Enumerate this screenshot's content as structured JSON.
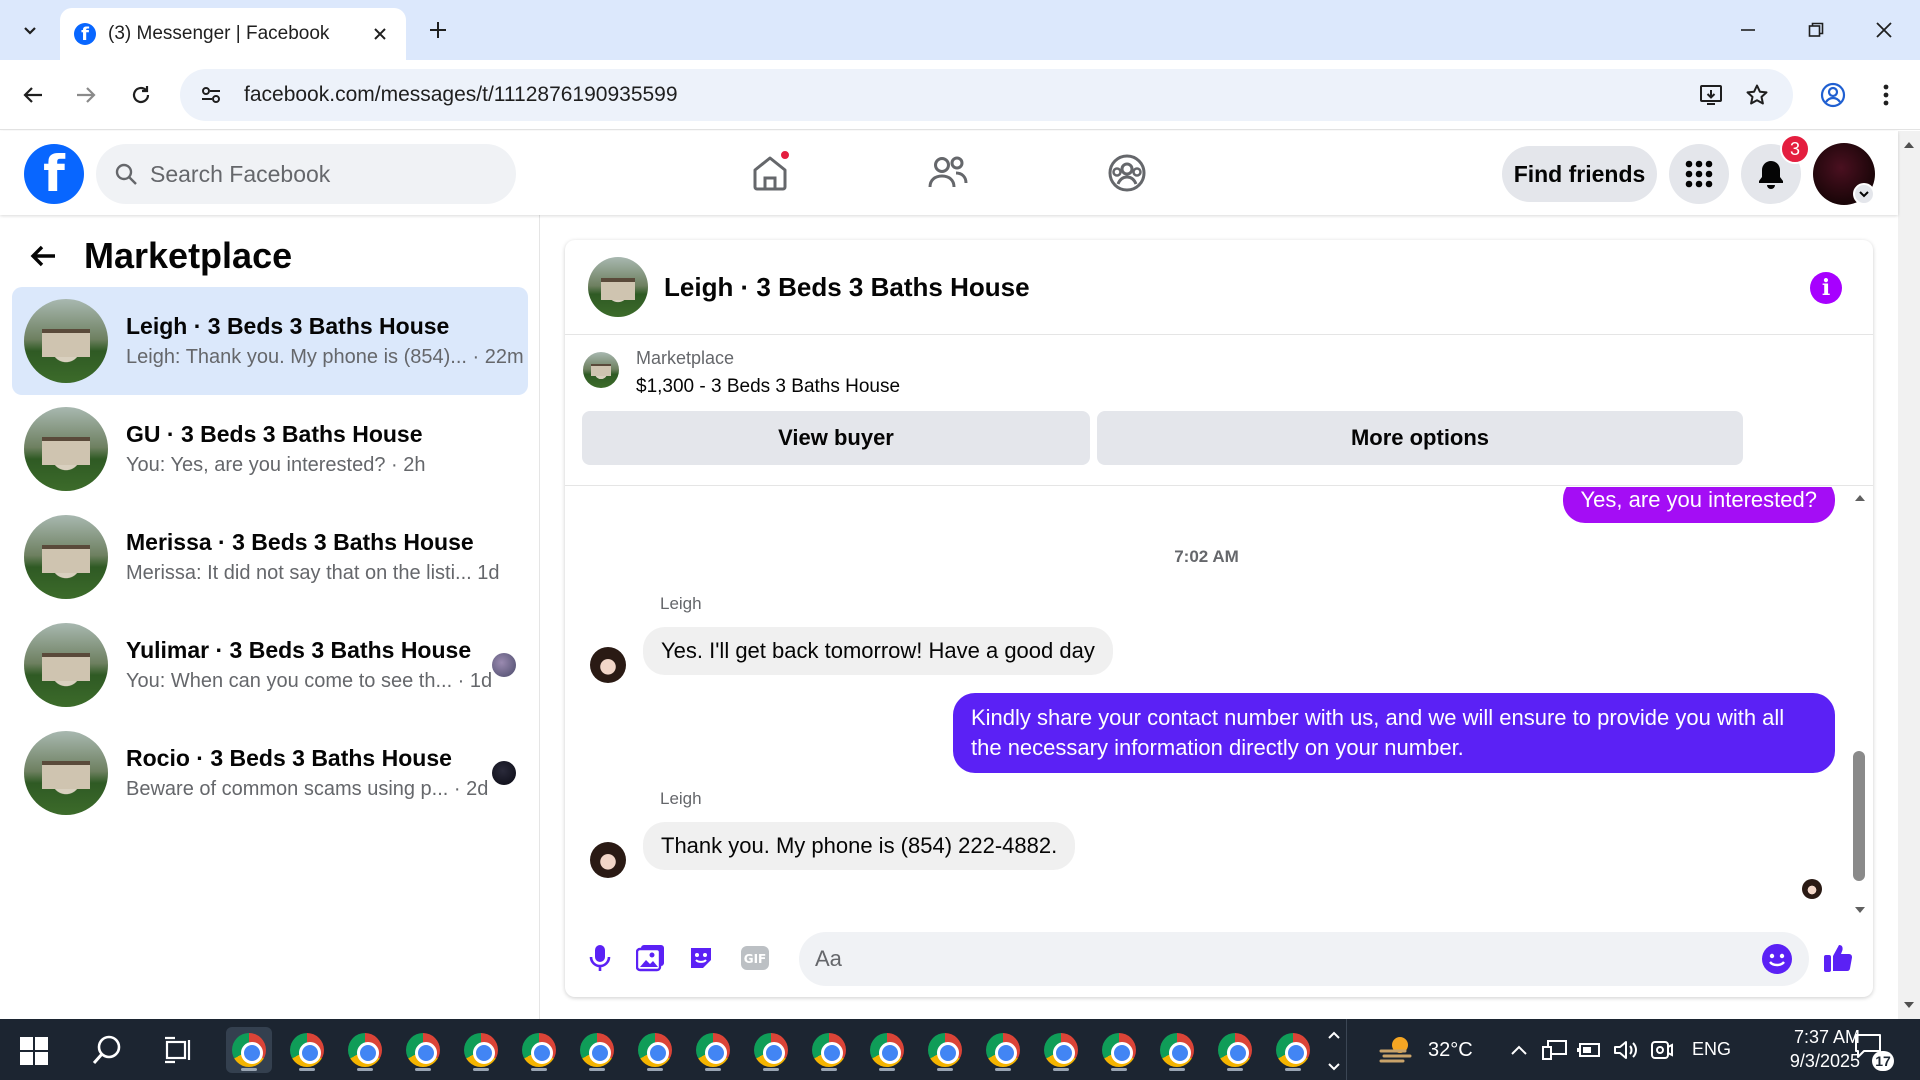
{
  "browser": {
    "tab_title": "(3) Messenger | Facebook",
    "url": "facebook.com/messages/t/1112876190935599"
  },
  "fb": {
    "search_placeholder": "Search Facebook",
    "find_friends": "Find friends",
    "notifications_count": "3"
  },
  "sidebar": {
    "title": "Marketplace",
    "conversations": [
      {
        "name": "Leigh · 3 Beds 3 Baths House",
        "preview": "Leigh: Thank you. My phone is (854)... · 22m",
        "active": true
      },
      {
        "name": "GU · 3 Beds 3 Baths House",
        "preview": "You: Yes, are you interested? · 2h"
      },
      {
        "name": "Merissa · 3 Beds 3 Baths House",
        "preview": "Merissa: It did not say that on the listi...  1d"
      },
      {
        "name": "Yulimar · 3 Beds 3 Baths House",
        "preview": "You: When can you come to see th... · 1d"
      },
      {
        "name": "Rocio · 3 Beds 3 Baths House",
        "preview": "Beware of common scams using p... · 2d"
      }
    ]
  },
  "chat": {
    "title": "Leigh · 3 Beds 3 Baths House",
    "marketplace_label": "Marketplace",
    "listing": "$1,300 - 3 Beds 3 Baths House",
    "view_buyer": "View buyer",
    "more_options": "More options",
    "messages": {
      "out_1": "Yes, are you interested?",
      "timestamp": "7:02 AM",
      "sender_1": "Leigh",
      "in_1": "Yes. I'll get back tomorrow! Have a good day",
      "out_2": "Kindly share your contact number with us, and we will ensure to provide you with all the necessary information directly on your number.",
      "sender_2": "Leigh",
      "in_2": "Thank you. My phone is (854) 222-4882."
    },
    "composer_placeholder": "Aa"
  },
  "taskbar": {
    "weather": "32°C",
    "lang": "ENG",
    "time": "7:37 AM",
    "date": "9/3/2025",
    "notification_count": "17"
  },
  "colors": {
    "fb_blue": "#0866ff",
    "out_bubble_purple": "#a40df5",
    "out_bubble_indigo": "#5b21f5",
    "active_conv": "#dbe8fb",
    "badge_red": "#e41e3f"
  }
}
